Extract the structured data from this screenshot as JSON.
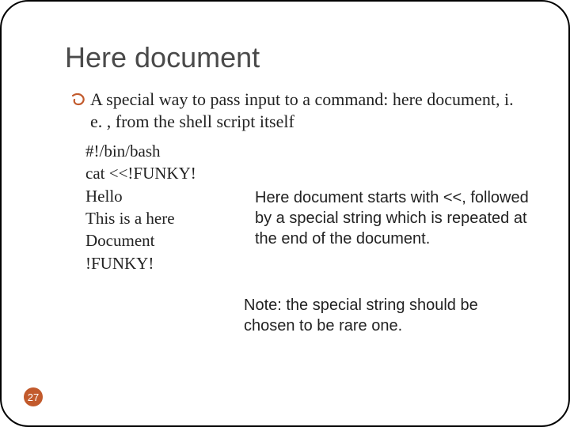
{
  "title": "Here document",
  "bullet": "A special way to pass input to a command: here document, i. e. , from the shell script itself",
  "code": {
    "l1": "#!/bin/bash",
    "l2": "cat <<!FUNKY!",
    "l3": "Hello",
    "l4": "This is a here",
    "l5": "Document",
    "l6": "!FUNKY!"
  },
  "annotation": "Here document starts with <<, followed by a special string which is repeated at the end of the document.",
  "note": "Note: the special string should be chosen to be rare one.",
  "page_number": "27",
  "icon_color": "#c25a2c"
}
